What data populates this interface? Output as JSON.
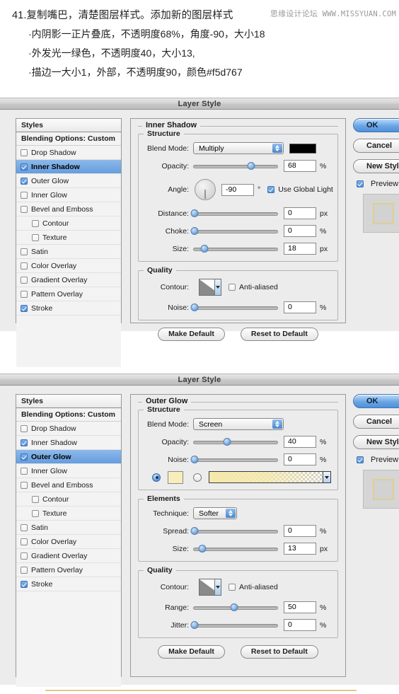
{
  "instructions": {
    "title": "41.复制嘴巴，清楚图层样式。添加新的图层样式",
    "bullet1": "·内阴影一正片叠底，不透明度68%，角度-90，大小18",
    "bullet2": "·外发光一绿色，不透明度40，大小13,",
    "bullet3": "·描边一大小1，外部，不透明度90，颜色#f5d767",
    "watermark_cn": "思缘设计论坛",
    "watermark_url": "WWW.MISSYUAN.COM"
  },
  "dialog_title": "Layer Style",
  "styles_panel": {
    "header": "Styles",
    "blending_options": "Blending Options: Custom",
    "items": [
      {
        "label": "Drop Shadow",
        "checked": false,
        "indent": false
      },
      {
        "label": "Inner Shadow",
        "checked": true,
        "indent": false
      },
      {
        "label": "Outer Glow",
        "checked": true,
        "indent": false
      },
      {
        "label": "Inner Glow",
        "checked": false,
        "indent": false
      },
      {
        "label": "Bevel and Emboss",
        "checked": false,
        "indent": false
      },
      {
        "label": "Contour",
        "checked": false,
        "indent": true
      },
      {
        "label": "Texture",
        "checked": false,
        "indent": true
      },
      {
        "label": "Satin",
        "checked": false,
        "indent": false
      },
      {
        "label": "Color Overlay",
        "checked": false,
        "indent": false
      },
      {
        "label": "Gradient Overlay",
        "checked": false,
        "indent": false
      },
      {
        "label": "Pattern Overlay",
        "checked": false,
        "indent": false
      },
      {
        "label": "Stroke",
        "checked": true,
        "indent": false
      }
    ],
    "selected_dialog1": "Inner Shadow",
    "selected_dialog2": "Outer Glow"
  },
  "right_panel": {
    "ok": "OK",
    "cancel": "Cancel",
    "new_style": "New Style...",
    "preview_label": "Preview",
    "preview_checked": true,
    "preview_stroke_color": "#dfce93"
  },
  "dialog1": {
    "panel_title": "Inner Shadow",
    "structure": {
      "legend": "Structure",
      "blend_mode_label": "Blend Mode:",
      "blend_mode_value": "Multiply",
      "blend_color": "#000000",
      "opacity_label": "Opacity:",
      "opacity_value": "68",
      "opacity_unit": "%",
      "opacity_percent": 68,
      "angle_label": "Angle:",
      "angle_value": "-90",
      "angle_unit": "°",
      "angle_degrees": -90,
      "use_global_light_label": "Use Global Light",
      "use_global_light_checked": true,
      "distance_label": "Distance:",
      "distance_value": "0",
      "distance_unit": "px",
      "distance_percent": 0,
      "choke_label": "Choke:",
      "choke_value": "0",
      "choke_unit": "%",
      "choke_percent": 0,
      "size_label": "Size:",
      "size_value": "18",
      "size_unit": "px",
      "size_percent": 12
    },
    "quality": {
      "legend": "Quality",
      "contour_label": "Contour:",
      "anti_aliased_label": "Anti-aliased",
      "anti_aliased_checked": false,
      "noise_label": "Noise:",
      "noise_value": "0",
      "noise_unit": "%",
      "noise_percent": 0
    },
    "make_default": "Make Default",
    "reset_to_default": "Reset to Default"
  },
  "dialog2": {
    "panel_title": "Outer Glow",
    "structure": {
      "legend": "Structure",
      "blend_mode_label": "Blend Mode:",
      "blend_mode_value": "Screen",
      "opacity_label": "Opacity:",
      "opacity_value": "40",
      "opacity_unit": "%",
      "opacity_percent": 40,
      "noise_label": "Noise:",
      "noise_value": "0",
      "noise_unit": "%",
      "noise_percent": 0,
      "color_mode": "solid",
      "solid_color": "#f8eebb",
      "gradient_from": "#f5e9ab",
      "gradient_to": "transparent"
    },
    "elements": {
      "legend": "Elements",
      "technique_label": "Technique:",
      "technique_value": "Softer",
      "spread_label": "Spread:",
      "spread_value": "0",
      "spread_unit": "%",
      "spread_percent": 0,
      "size_label": "Size:",
      "size_value": "13",
      "size_unit": "px",
      "size_percent": 10
    },
    "quality": {
      "legend": "Quality",
      "contour_label": "Contour:",
      "anti_aliased_label": "Anti-aliased",
      "anti_aliased_checked": false,
      "range_label": "Range:",
      "range_value": "50",
      "range_unit": "%",
      "range_percent": 48,
      "jitter_label": "Jitter:",
      "jitter_value": "0",
      "jitter_unit": "%",
      "jitter_percent": 0
    },
    "make_default": "Make Default",
    "reset_to_default": "Reset to Default"
  }
}
